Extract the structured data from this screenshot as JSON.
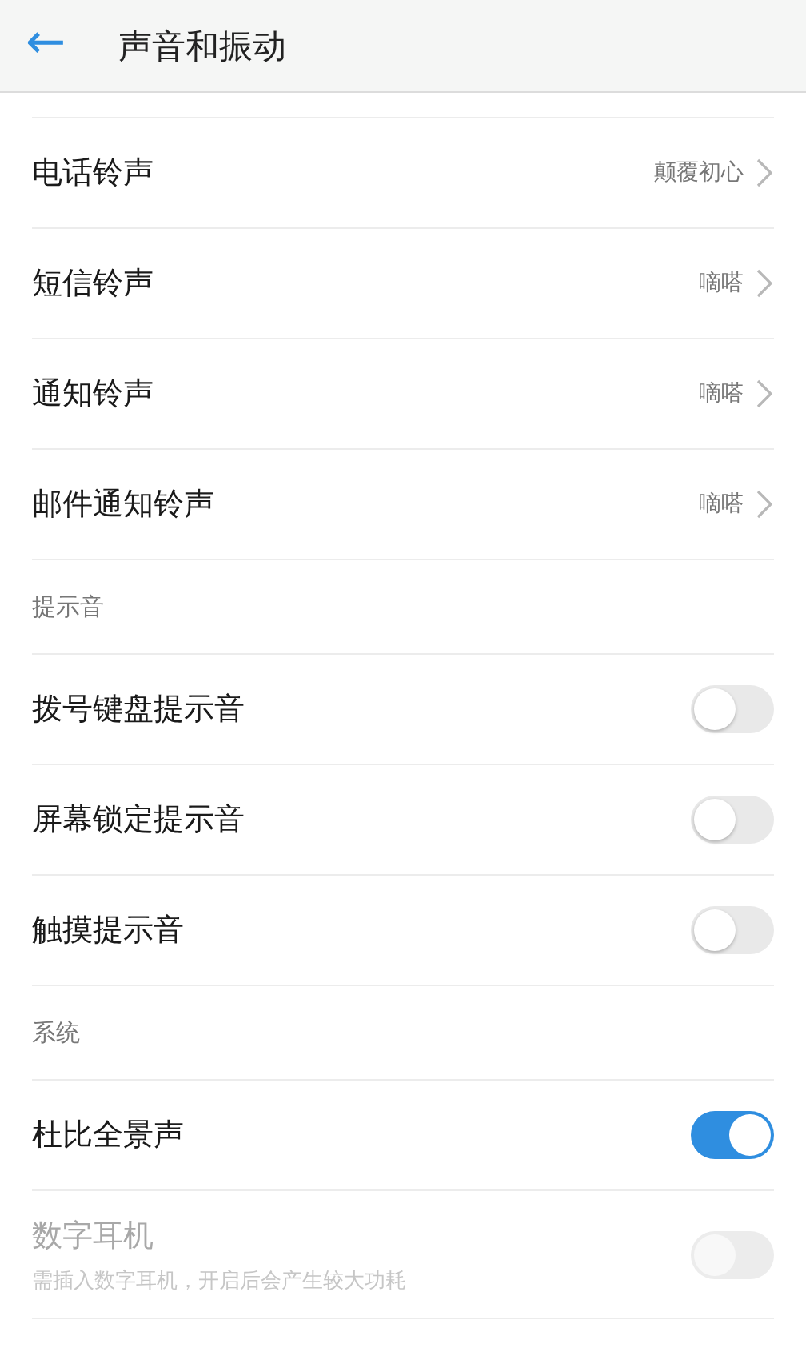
{
  "header": {
    "back_icon": "←",
    "title": "声音和振动"
  },
  "sections": [
    {
      "items": [
        {
          "kind": "link",
          "label": "电话铃声",
          "value": "颠覆初心"
        },
        {
          "kind": "link",
          "label": "短信铃声",
          "value": "嘀嗒"
        },
        {
          "kind": "link",
          "label": "通知铃声",
          "value": "嘀嗒"
        },
        {
          "kind": "link",
          "label": "邮件通知铃声",
          "value": "嘀嗒"
        }
      ]
    },
    {
      "title": "提示音",
      "items": [
        {
          "kind": "switch",
          "label": "拨号键盘提示音",
          "on": false,
          "disabled": false
        },
        {
          "kind": "switch",
          "label": "屏幕锁定提示音",
          "on": false,
          "disabled": false
        },
        {
          "kind": "switch",
          "label": "触摸提示音",
          "on": false,
          "disabled": false
        }
      ]
    },
    {
      "title": "系统",
      "items": [
        {
          "kind": "switch",
          "label": "杜比全景声",
          "on": true,
          "disabled": false
        },
        {
          "kind": "switch",
          "label": "数字耳机",
          "subtitle": "需插入数字耳机，开启后会产生较大功耗",
          "on": false,
          "disabled": true
        }
      ]
    }
  ]
}
